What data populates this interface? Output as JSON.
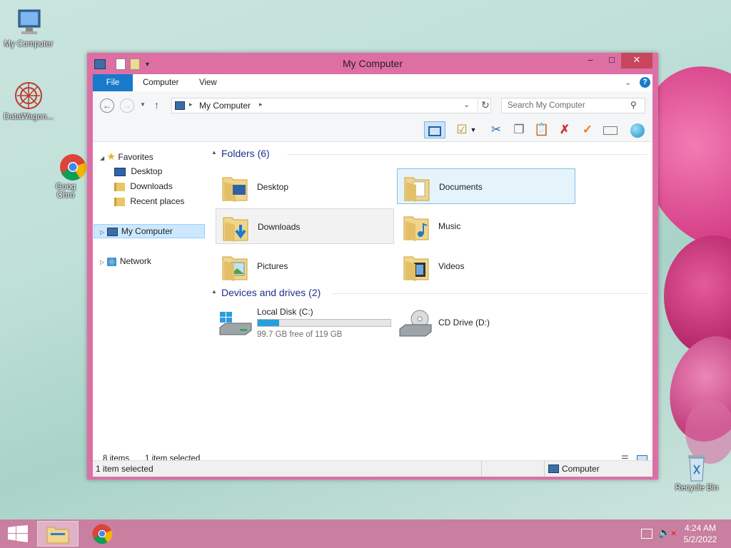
{
  "desktop": {
    "icons": [
      {
        "label": "My Computer"
      },
      {
        "label": "DataWagon..."
      },
      {
        "label": "Goog Chro"
      },
      {
        "label": "Recycle Bin"
      }
    ]
  },
  "window": {
    "title": "My Computer",
    "controls": {
      "minimize": "–",
      "maximize": "□",
      "close": "✕"
    },
    "ribbon_tabs": [
      "File",
      "Computer",
      "View"
    ],
    "address": {
      "segment": "My Computer"
    },
    "search": {
      "placeholder": "Search My Computer"
    },
    "nav": {
      "favorites": "Favorites",
      "favorites_items": [
        "Desktop",
        "Downloads",
        "Recent places"
      ],
      "my_computer": "My Computer",
      "network": "Network"
    },
    "groups": {
      "folders": "Folders (6)",
      "devices": "Devices and drives (2)"
    },
    "folders": [
      {
        "label": "Desktop",
        "icon": "desktop-folder-icon"
      },
      {
        "label": "Documents",
        "icon": "documents-folder-icon"
      },
      {
        "label": "Downloads",
        "icon": "downloads-folder-icon"
      },
      {
        "label": "Music",
        "icon": "music-folder-icon"
      },
      {
        "label": "Pictures",
        "icon": "pictures-folder-icon"
      },
      {
        "label": "Videos",
        "icon": "videos-folder-icon"
      }
    ],
    "drives": {
      "local_disk": {
        "label": "Local Disk (C:)",
        "free_text": "99.7 GB free of 119 GB",
        "used_fraction": 0.162
      },
      "cd_drive": {
        "label": "CD Drive (D:)"
      }
    },
    "status": {
      "items": "8 items",
      "selected": "1 item selected",
      "bottom_left": "1 item selected",
      "bottom_right": "Computer"
    }
  },
  "taskbar": {
    "time": "4:24 AM",
    "date": "5/2/2022"
  },
  "colors": {
    "window_frame": "#dd6fa5",
    "file_tab": "#1979ca",
    "selection": "#cce8ff",
    "group_header": "#1e3287",
    "taskbar": "#c97f9f"
  }
}
